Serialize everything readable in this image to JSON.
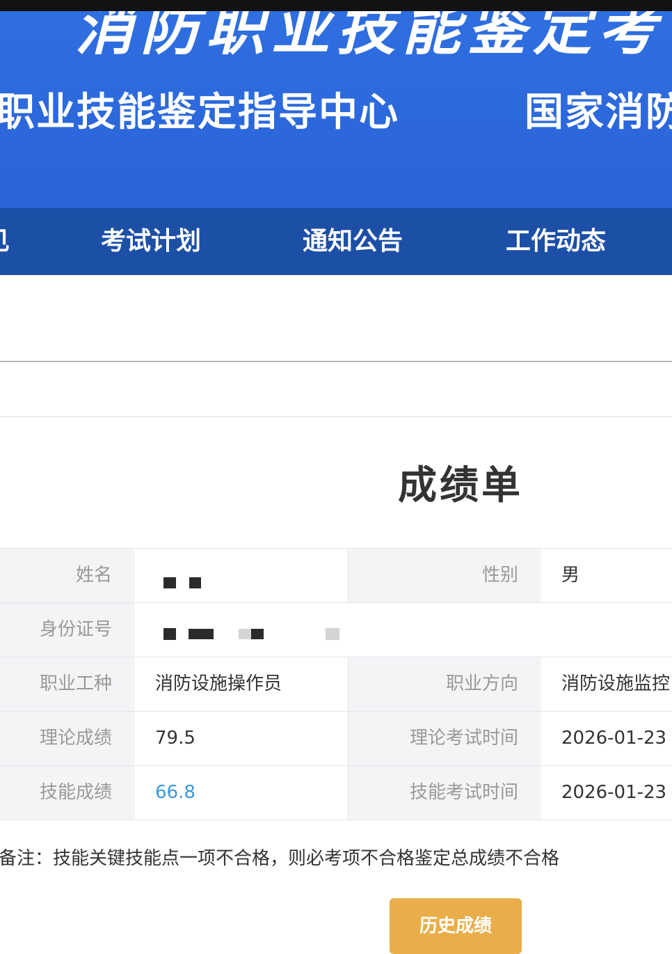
{
  "header": {
    "title": "消防职业技能鉴定考",
    "subtitle_left": "职业技能鉴定指导中心",
    "subtitle_right": "国家消防"
  },
  "nav": {
    "items": [
      {
        "label": "见"
      },
      {
        "label": "考试计划"
      },
      {
        "label": "通知公告"
      },
      {
        "label": "工作动态"
      }
    ]
  },
  "report": {
    "title": "成绩单",
    "rows": [
      {
        "label": "姓名",
        "value": "",
        "label2": "性别",
        "value2": "男"
      },
      {
        "label": "身份证号",
        "value": ""
      },
      {
        "label": "职业工种",
        "value": "消防设施操作员",
        "label2": "职业方向",
        "value2": "消防设施监控"
      },
      {
        "label": "理论成绩",
        "value": "79.5",
        "label2": "理论考试时间",
        "value2": "2026-01-23"
      },
      {
        "label": "技能成绩",
        "value": "66.8",
        "label2": "技能考试时间",
        "value2": "2026-01-23"
      }
    ],
    "note": "备注：技能关键技能点一项不合格，则必考项不合格鉴定总成绩不合格"
  },
  "buttons": {
    "history": "历史成绩"
  },
  "colors": {
    "banner_blue": "#2c68dc",
    "nav_blue": "#1c4fa6",
    "skill_score": "#3c98d8",
    "button_orange": "#e9ae4a"
  }
}
